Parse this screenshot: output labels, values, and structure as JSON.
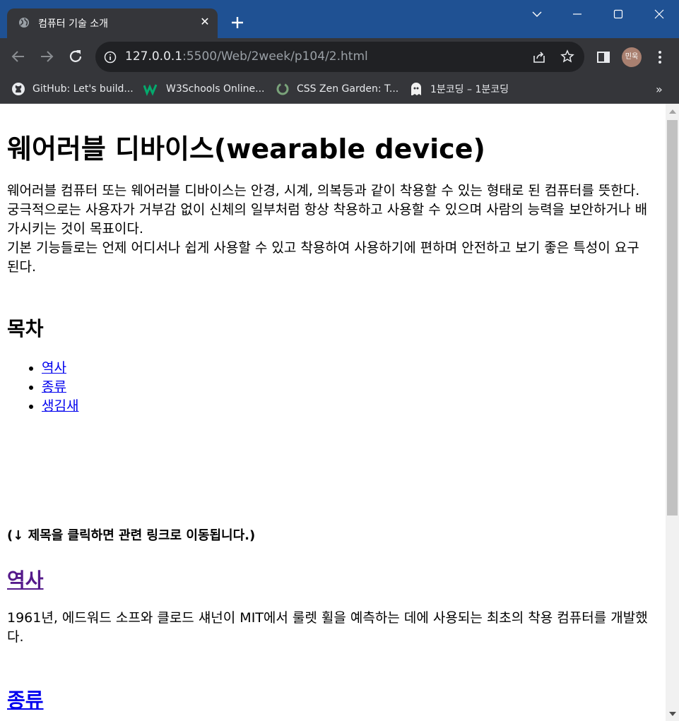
{
  "browser": {
    "tab_title": "컴퓨터 기술 소개",
    "tab_close": "✕",
    "url_host": "127.0.0.1",
    "url_path": ":5500/Web/2week/p104/2.html",
    "profile_label": "민욱",
    "bookmarks": [
      {
        "label": "GitHub: Let's build...",
        "icon": "github-icon"
      },
      {
        "label": "W3Schools Online...",
        "icon": "w3schools-icon"
      },
      {
        "label": "CSS Zen Garden: T...",
        "icon": "zen-garden-icon"
      },
      {
        "label": "1분코딩 – 1분코딩",
        "icon": "coding-ghost-icon"
      }
    ],
    "bookmarks_more": "»"
  },
  "page": {
    "title": "웨어러블 디바이스(wearable device)",
    "intro_lines": [
      "웨어러블 컴퓨터 또는 웨어러블 디바이스는 안경, 시계, 의복등과 같이 착용할 수 있는 형태로 된 컴퓨터를 뜻한다.",
      "궁극적으로는 사용자가 거부감 없이 신체의 일부처럼 항상 착용하고 사용할 수 있으며 사람의 능력을 보안하거나 배가시키는 것이 목표이다.",
      "기본 기능들로는 언제 어디서나 쉽게 사용할 수 있고 착용하여 사용하기에 편하며 안전하고 보기 좋은 특성이 요구된다."
    ],
    "toc_title": "목차",
    "toc_items": [
      "역사",
      "종류",
      "생김새"
    ],
    "hint": "(↓ 제목을 클릭하면 관련 링크로 이동됩니다.)",
    "section_history_title": "역사",
    "section_history_text": "1961년, 에드워드 소프와 클로드 섀넌이 MIT에서 룰렛 휠을 예측하는 데에 사용되는 최초의 착용 컴퓨터를 개발했다.",
    "section_types_title": "종류"
  },
  "colors": {
    "titlebar": "#1f5193",
    "toolbar": "#35363a",
    "link": "#0000ee",
    "visited_link": "#551a8b"
  }
}
